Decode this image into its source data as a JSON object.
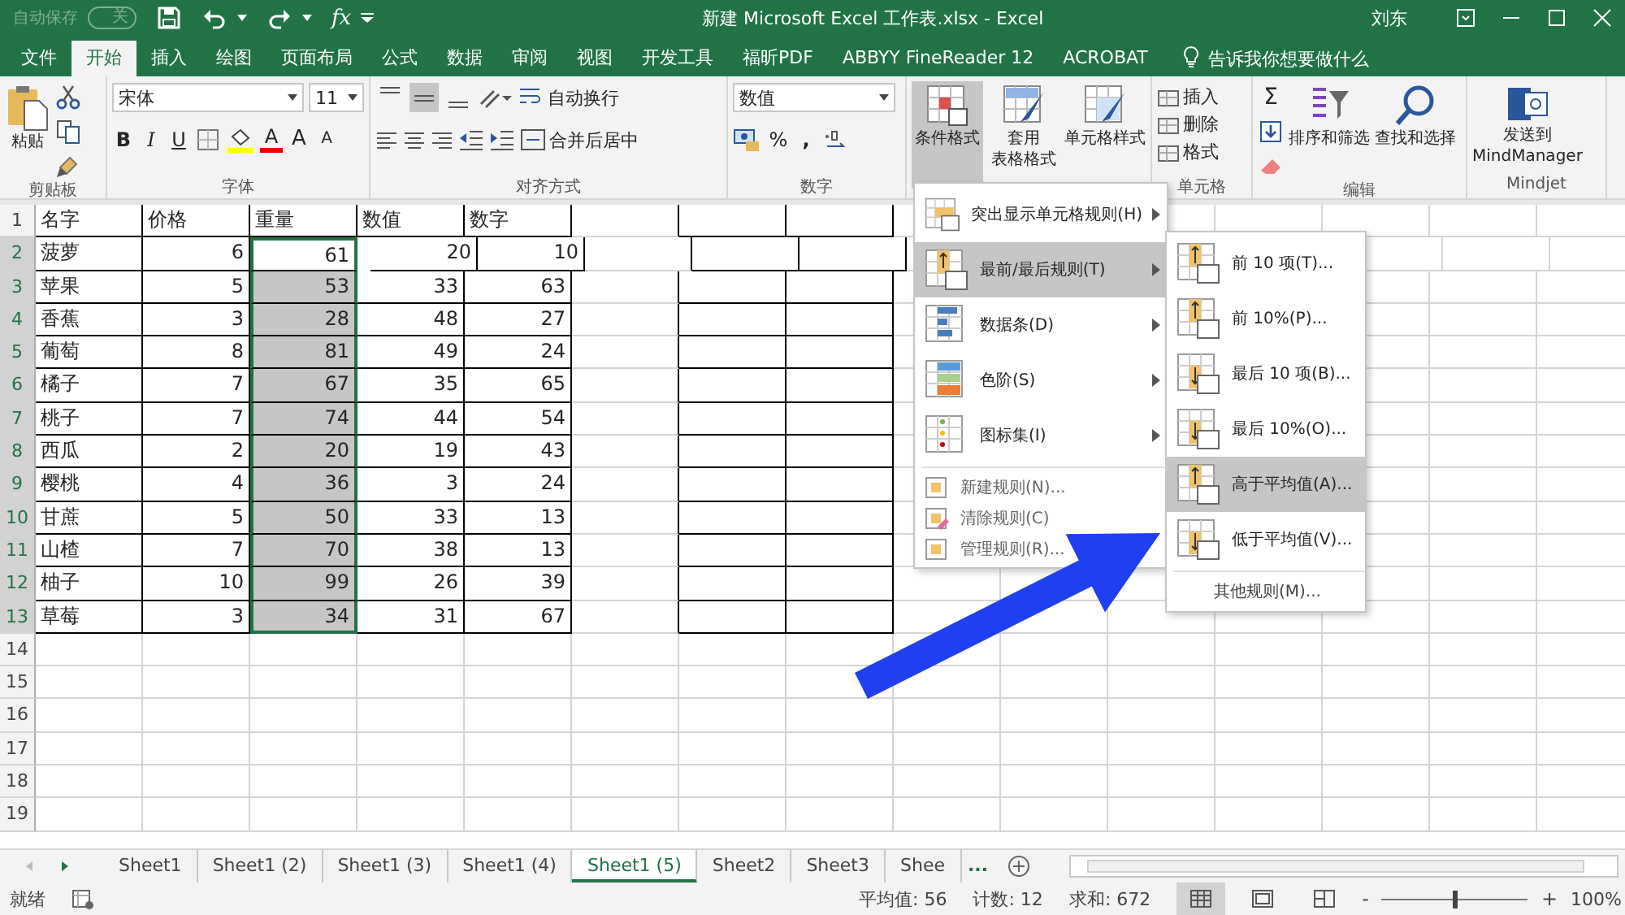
{
  "title_bar": {
    "autosave": {
      "label": "自动保存",
      "state": "关",
      "on": false
    },
    "formula_symbol": "fx",
    "title": "新建 Microsoft Excel 工作表.xlsx  -  Excel",
    "user": "刘东"
  },
  "tabs": [
    {
      "label": "文件",
      "selected": false
    },
    {
      "label": "开始",
      "selected": true
    },
    {
      "label": "插入",
      "selected": false
    },
    {
      "label": "绘图",
      "selected": false
    },
    {
      "label": "页面布局",
      "selected": false
    },
    {
      "label": "公式",
      "selected": false
    },
    {
      "label": "数据",
      "selected": false
    },
    {
      "label": "审阅",
      "selected": false
    },
    {
      "label": "视图",
      "selected": false
    },
    {
      "label": "开发工具",
      "selected": false
    },
    {
      "label": "福昕PDF",
      "selected": false
    },
    {
      "label": "ABBYY FineReader 12",
      "selected": false
    },
    {
      "label": "ACROBAT",
      "selected": false
    }
  ],
  "tell_me": {
    "placeholder": "告诉我你想要做什么"
  },
  "ribbon": {
    "clipboard": {
      "paste": "粘贴",
      "label": "剪贴板"
    },
    "font": {
      "name": "宋体",
      "size": "11",
      "grow": "A",
      "shrink": "A",
      "bold": "B",
      "italic": "I",
      "underline": "U",
      "font_color": "A",
      "label": "字体"
    },
    "alignment": {
      "vertical": [
        {
          "selected": false
        },
        {
          "selected": true
        },
        {
          "selected": false
        }
      ],
      "wrap": "自动换行",
      "merge": "合并后居中",
      "label": "对齐方式"
    },
    "number": {
      "format": "数值",
      "percent": "%",
      "comma": ",",
      "label": "数字"
    },
    "styles": [
      {
        "lines": [
          "条件格式"
        ],
        "selected": true
      },
      {
        "lines": [
          "套用",
          "表格格式"
        ],
        "selected": false
      },
      {
        "lines": [
          "单元格样式"
        ],
        "selected": false
      }
    ],
    "cells": {
      "items": [
        "插入",
        "删除",
        "格式"
      ],
      "label": "单元格"
    },
    "editing": {
      "sum": "Σ",
      "buttons": [
        {
          "lines": [
            "排序和筛选"
          ]
        },
        {
          "lines": [
            "查找和选择"
          ]
        }
      ],
      "label": "编辑"
    },
    "mindjet": {
      "lines": [
        "发送到",
        "MindManager"
      ],
      "label": "Mindjet"
    }
  },
  "sheet": {
    "header_row": {
      "number": "1",
      "cells": [
        "名字",
        "价格",
        "重量",
        "数值",
        "数字"
      ]
    },
    "rows": [
      {
        "number": "2",
        "cells": [
          "菠萝",
          "6",
          "61",
          "20",
          "10"
        ],
        "in_selection": true,
        "active": true
      },
      {
        "number": "3",
        "cells": [
          "苹果",
          "5",
          "53",
          "33",
          "63"
        ],
        "in_selection": true,
        "active": false
      },
      {
        "number": "4",
        "cells": [
          "香蕉",
          "3",
          "28",
          "48",
          "27"
        ],
        "in_selection": true,
        "active": false
      },
      {
        "number": "5",
        "cells": [
          "葡萄",
          "8",
          "81",
          "49",
          "24"
        ],
        "in_selection": true,
        "active": false
      },
      {
        "number": "6",
        "cells": [
          "橘子",
          "7",
          "67",
          "35",
          "65"
        ],
        "in_selection": true,
        "active": false
      },
      {
        "number": "7",
        "cells": [
          "桃子",
          "7",
          "74",
          "44",
          "54"
        ],
        "in_selection": true,
        "active": false
      },
      {
        "number": "8",
        "cells": [
          "西瓜",
          "2",
          "20",
          "19",
          "43"
        ],
        "in_selection": true,
        "active": false
      },
      {
        "number": "9",
        "cells": [
          "樱桃",
          "4",
          "36",
          "3",
          "24"
        ],
        "in_selection": true,
        "active": false
      },
      {
        "number": "10",
        "cells": [
          "甘蔗",
          "5",
          "50",
          "33",
          "13"
        ],
        "in_selection": true,
        "active": false
      },
      {
        "number": "11",
        "cells": [
          "山楂",
          "7",
          "70",
          "38",
          "13"
        ],
        "in_selection": true,
        "active": false
      },
      {
        "number": "12",
        "cells": [
          "柚子",
          "10",
          "99",
          "26",
          "39"
        ],
        "in_selection": true,
        "active": false
      },
      {
        "number": "13",
        "cells": [
          "草莓",
          "3",
          "34",
          "31",
          "67"
        ],
        "in_selection": true,
        "active": false
      }
    ],
    "empty_rows": [
      "14",
      "15",
      "16",
      "17",
      "18",
      "19"
    ]
  },
  "menu": {
    "items": [
      {
        "label": "突出显示单元格规则(H)",
        "kind": "large",
        "submenu": true,
        "selected": false
      },
      {
        "label": "最前/最后规则(T)",
        "kind": "large",
        "submenu": true,
        "selected": true
      },
      {
        "label": "数据条(D)",
        "kind": "large",
        "submenu": true,
        "selected": false
      },
      {
        "label": "色阶(S)",
        "kind": "large",
        "submenu": true,
        "selected": false
      },
      {
        "label": "图标集(I)",
        "kind": "large",
        "submenu": true,
        "selected": false
      },
      {
        "label": "新建规则(N)...",
        "kind": "small",
        "submenu": false,
        "selected": false
      },
      {
        "label": "清除规则(C)",
        "kind": "small",
        "submenu": false,
        "selected": false
      },
      {
        "label": "管理规则(R)...",
        "kind": "small",
        "submenu": false,
        "selected": false
      }
    ]
  },
  "submenu": {
    "items": [
      {
        "label": "前 10 项(T)...",
        "kind": "large",
        "selected": false
      },
      {
        "label": "前 10%(P)...",
        "kind": "large",
        "selected": false
      },
      {
        "label": "最后 10 项(B)...",
        "kind": "large",
        "selected": false
      },
      {
        "label": "最后 10%(O)...",
        "kind": "large",
        "selected": false
      },
      {
        "label": "高于平均值(A)...",
        "kind": "large",
        "selected": true
      },
      {
        "label": "低于平均值(V)...",
        "kind": "large",
        "selected": false
      },
      {
        "label": "其他规则(M)...",
        "kind": "plain",
        "selected": false
      }
    ]
  },
  "sheet_tabs": {
    "tabs": [
      {
        "label": "Sheet1",
        "selected": false
      },
      {
        "label": "Sheet1 (2)",
        "selected": false
      },
      {
        "label": "Sheet1 (3)",
        "selected": false
      },
      {
        "label": "Sheet1 (4)",
        "selected": false
      },
      {
        "label": "Sheet1 (5)",
        "selected": true
      },
      {
        "label": "Sheet2",
        "selected": false
      },
      {
        "label": "Sheet3",
        "selected": false
      },
      {
        "label": "Shee",
        "selected": false
      }
    ],
    "more": "..."
  },
  "status_bar": {
    "ready": "就绪",
    "average": "平均值: 56",
    "count": "计数: 12",
    "sum": "求和: 672",
    "views": [
      {
        "selected": true
      },
      {
        "selected": false
      },
      {
        "selected": false
      }
    ],
    "zoom": {
      "minus": "-",
      "plus": "+",
      "level": 0.5,
      "value": "100%"
    }
  }
}
